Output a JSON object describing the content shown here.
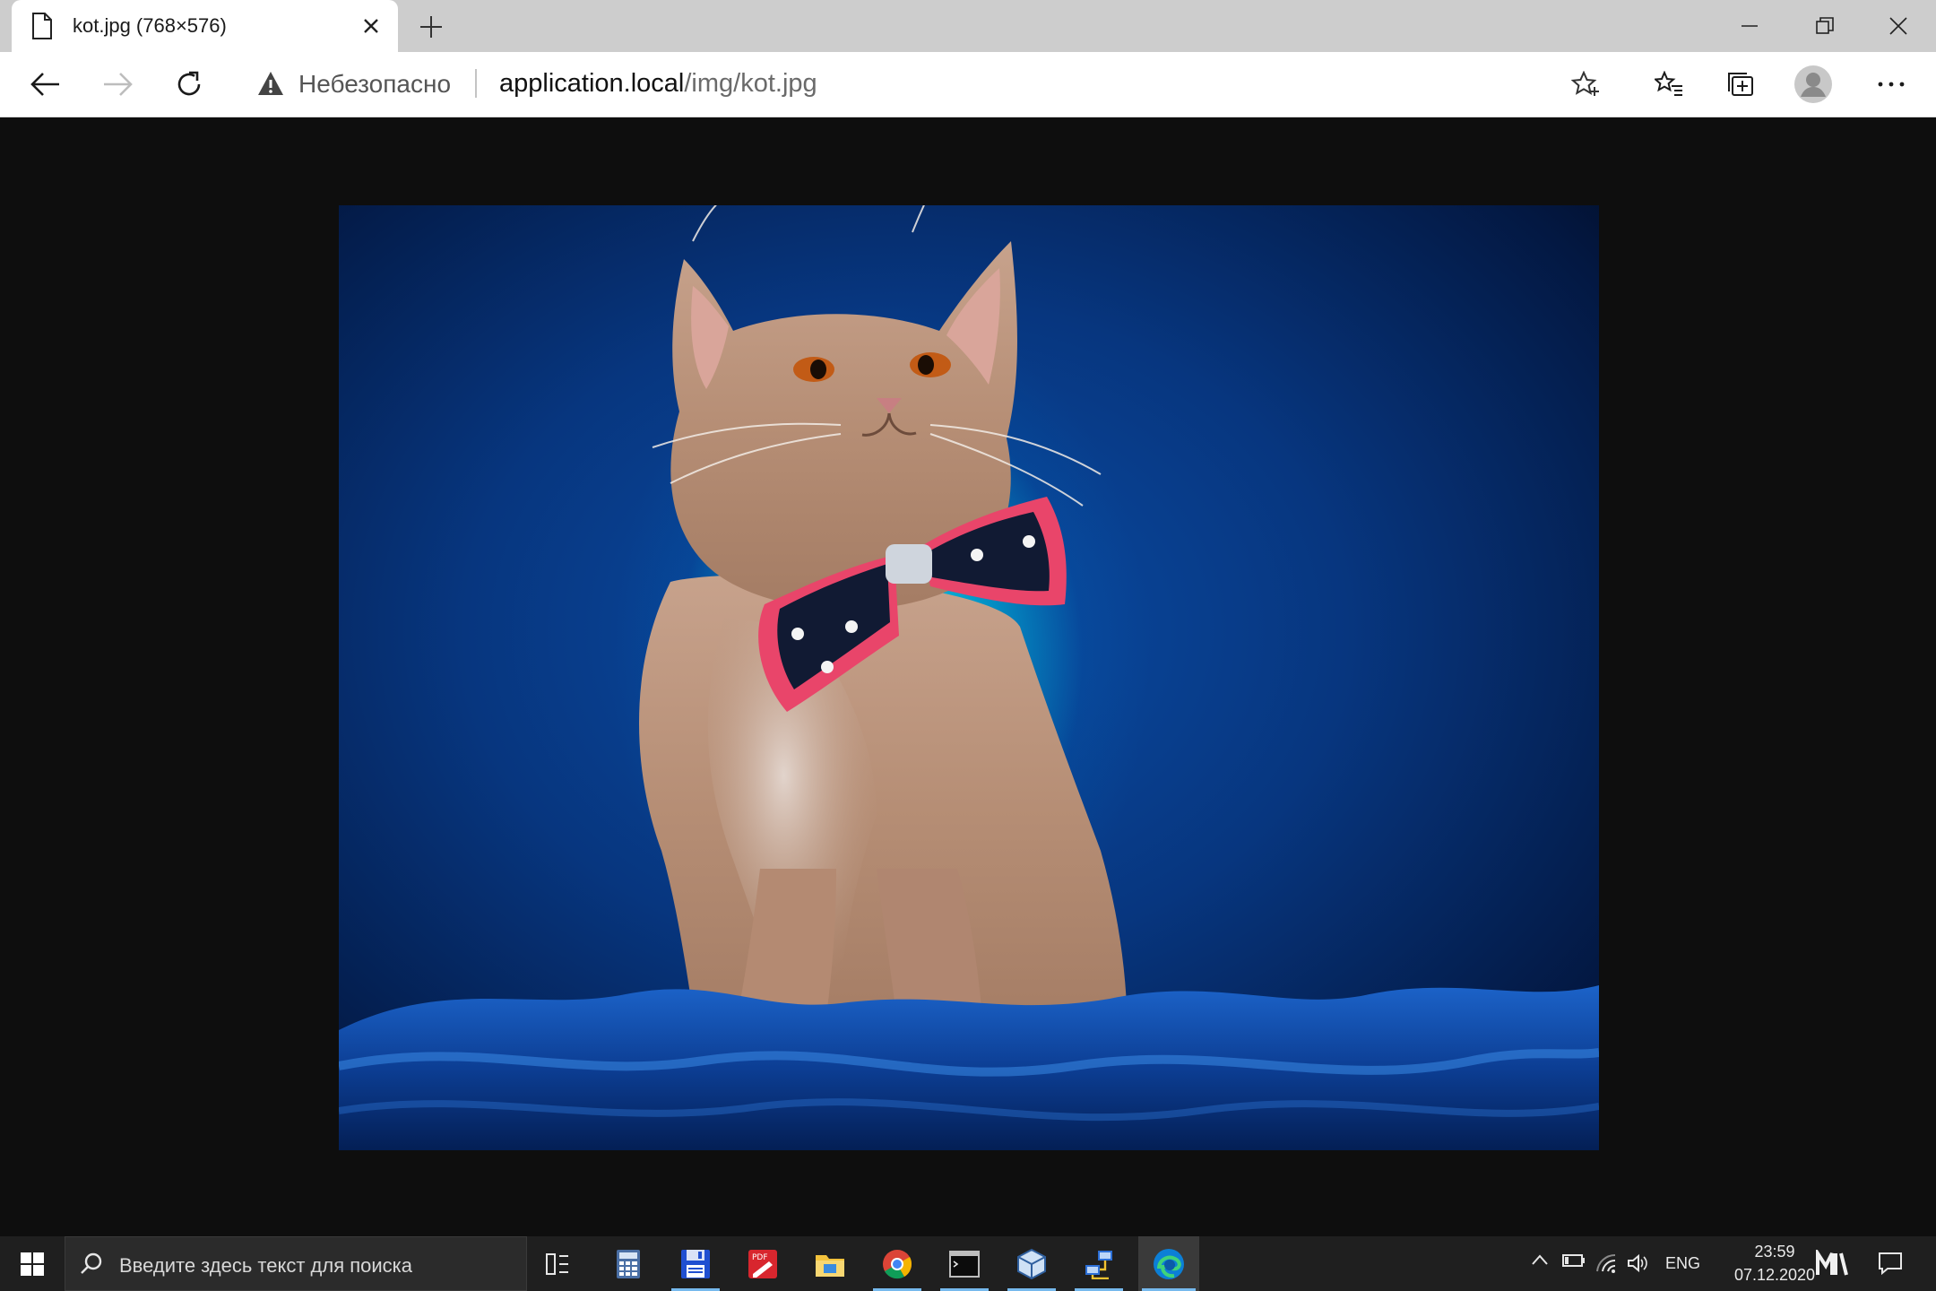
{
  "tab": {
    "title": "kot.jpg (768×576)"
  },
  "addressbar": {
    "security_label": "Небезопасно",
    "url_host": "application.local",
    "url_path": "/img/kot.jpg"
  },
  "image": {
    "subject": "cat-with-bow-tie"
  },
  "taskbar": {
    "search_placeholder": "Введите здесь текст для поиска",
    "apps": [
      "task-view",
      "calculator",
      "floppy-app",
      "pdf-editor",
      "file-explorer",
      "chrome",
      "terminal",
      "virtualbox",
      "network-app",
      "edge"
    ],
    "language": "ENG",
    "time": "23:59",
    "date": "07.12.2020"
  },
  "colors": {
    "tabstrip": "#cdcdcd",
    "viewer_background": "#0e0e0e",
    "taskbar": "#1f1f1f",
    "running_indicator": "#76b9ed"
  }
}
